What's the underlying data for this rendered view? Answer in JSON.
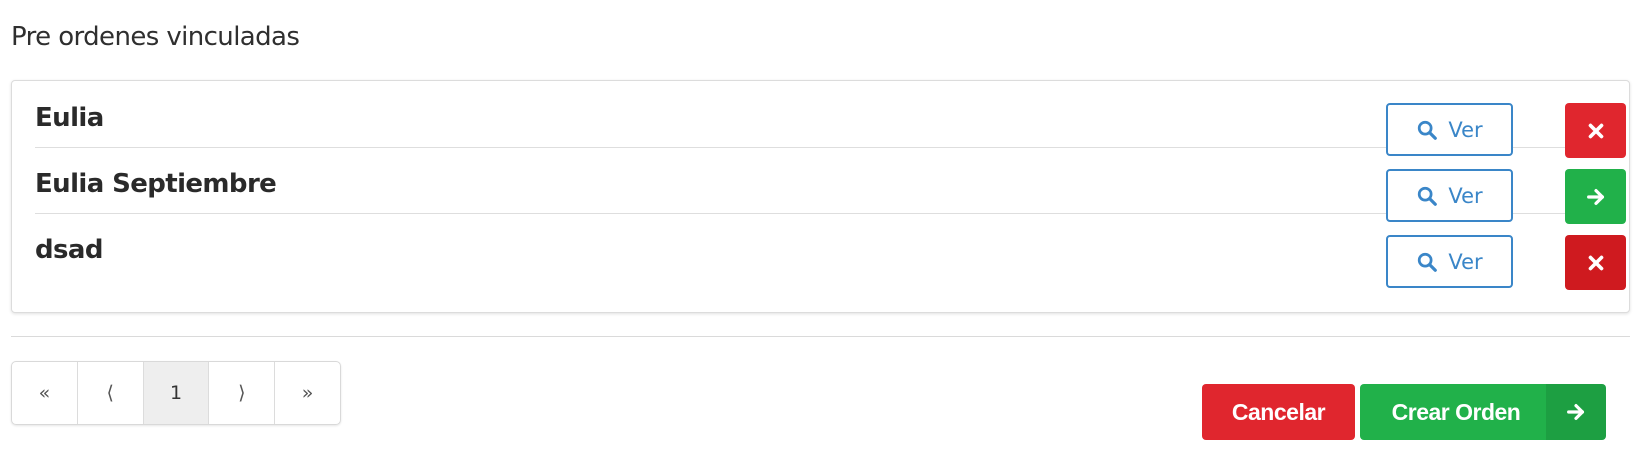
{
  "section": {
    "title": "Pre ordenes vinculadas"
  },
  "rows": [
    {
      "name": "Eulia",
      "view_label": "Ver",
      "action_icon": "close-icon",
      "action_color": "#e0262e"
    },
    {
      "name": "Eulia Septiembre",
      "view_label": "Ver",
      "action_icon": "arrow-right-icon",
      "action_color": "#21b14a"
    },
    {
      "name": "dsad",
      "view_label": "Ver",
      "action_icon": "close-icon",
      "action_color": "#cf1a1f"
    }
  ],
  "pagination": {
    "first": "«",
    "prev": "⟨",
    "current": "1",
    "next": "⟩",
    "last": "»"
  },
  "footer": {
    "cancel_label": "Cancelar",
    "create_label": "Crear Orden"
  },
  "colors": {
    "primary_outline": "#3a86c8",
    "danger": "#e0262e",
    "success": "#21b14a"
  }
}
